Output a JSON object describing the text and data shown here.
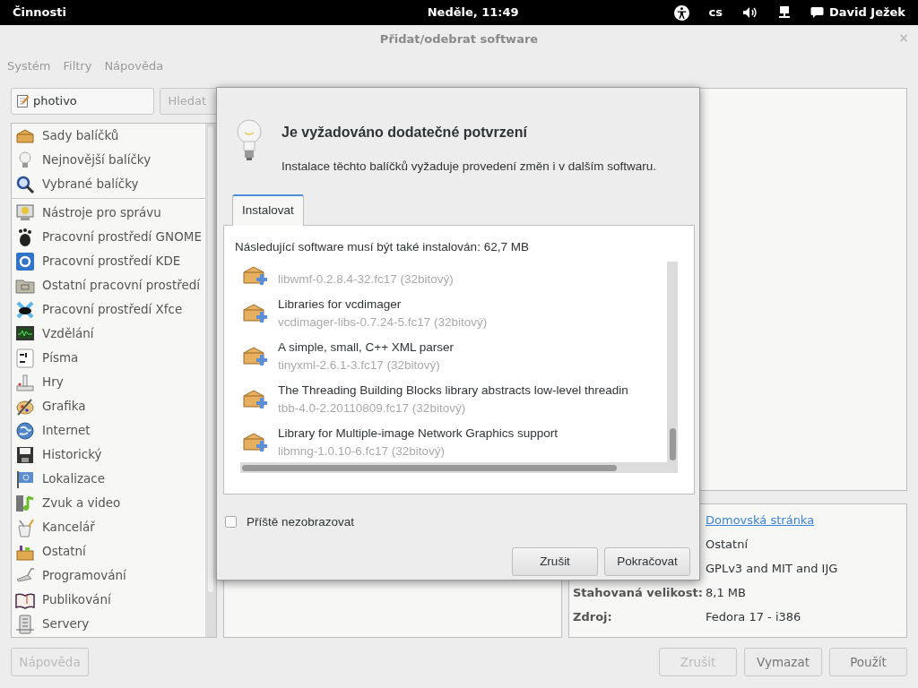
{
  "top_bar": {
    "activities": "Činnosti",
    "clock": "Neděle, 11:49",
    "language": "cs",
    "user": "David Ježek"
  },
  "window": {
    "title": "Přidat/odebrat software",
    "close": "×"
  },
  "menu": [
    "Systém",
    "Filtry",
    "Nápověda"
  ],
  "search": {
    "value": "photivo",
    "button": "Hledat"
  },
  "category_groups": [
    [
      "Sady balíčků",
      "Nejnovější balíčky",
      "Vybrané balíčky"
    ],
    [
      "Nástroje pro správu",
      "Pracovní prostředí GNOME",
      "Pracovní prostředí KDE",
      "Ostatní pracovní prostředí",
      "Pracovní prostředí Xfce",
      "Vzdělání",
      "Písma",
      "Hry",
      "Grafika",
      "Internet",
      "Historický",
      "Lokalizace",
      "Zvuk a video",
      "Kancelář",
      "Ostatní",
      "Programování",
      "Publikování",
      "Servery"
    ]
  ],
  "details": [
    {
      "value": "Domovská stránka",
      "kind": "link"
    },
    {
      "value": "Ostatní",
      "kind": "text"
    },
    {
      "value": "GPLv3 and MIT and IJG",
      "kind": "text"
    },
    {
      "label": "Stahovaná velikost:",
      "value": "8,1 MB",
      "kind": "text"
    },
    {
      "label": "Zdroj:",
      "value": "Fedora 17 - i386",
      "kind": "text"
    }
  ],
  "left_buttons": [
    {
      "label": "Nápověda",
      "disabled": true
    }
  ],
  "right_buttons": [
    {
      "label": "Zrušit",
      "disabled": true
    },
    {
      "label": "Vymazat",
      "disabled": false
    },
    {
      "label": "Použít",
      "disabled": false
    }
  ],
  "dialog": {
    "title": "Je vyžadováno dodatečné potvrzení",
    "message": "Instalace těchto balíčků vyžaduje provedení změn i v dalším softwaru.",
    "tabs": [
      {
        "label": "Instalovat",
        "selected": true
      }
    ],
    "heading": "Následující software musí být také instalován: 62,7 MB",
    "packages": [
      {
        "name": "libwmf-0.2.8.4-32.fc17 (32bitový)"
      },
      {
        "summary": "Libraries for vcdimager",
        "name": "vcdimager-libs-0.7.24-5.fc17 (32bitový)"
      },
      {
        "summary": "A simple, small, C++ XML parser",
        "name": "tinyxml-2.6.1-3.fc17 (32bitový)"
      },
      {
        "summary": "The Threading Building Blocks library abstracts low-level threadin",
        "name": "tbb-4.0-2.20110809.fc17 (32bitový)"
      },
      {
        "summary": "Library for Multiple-image Network Graphics support",
        "name": "libmng-1.0.10-6.fc17 (32bitový)"
      }
    ],
    "checkbox": {
      "label": "Příště nezobrazovat",
      "checked": false
    },
    "buttons": [
      "Zrušit",
      "Pokračovat"
    ]
  }
}
